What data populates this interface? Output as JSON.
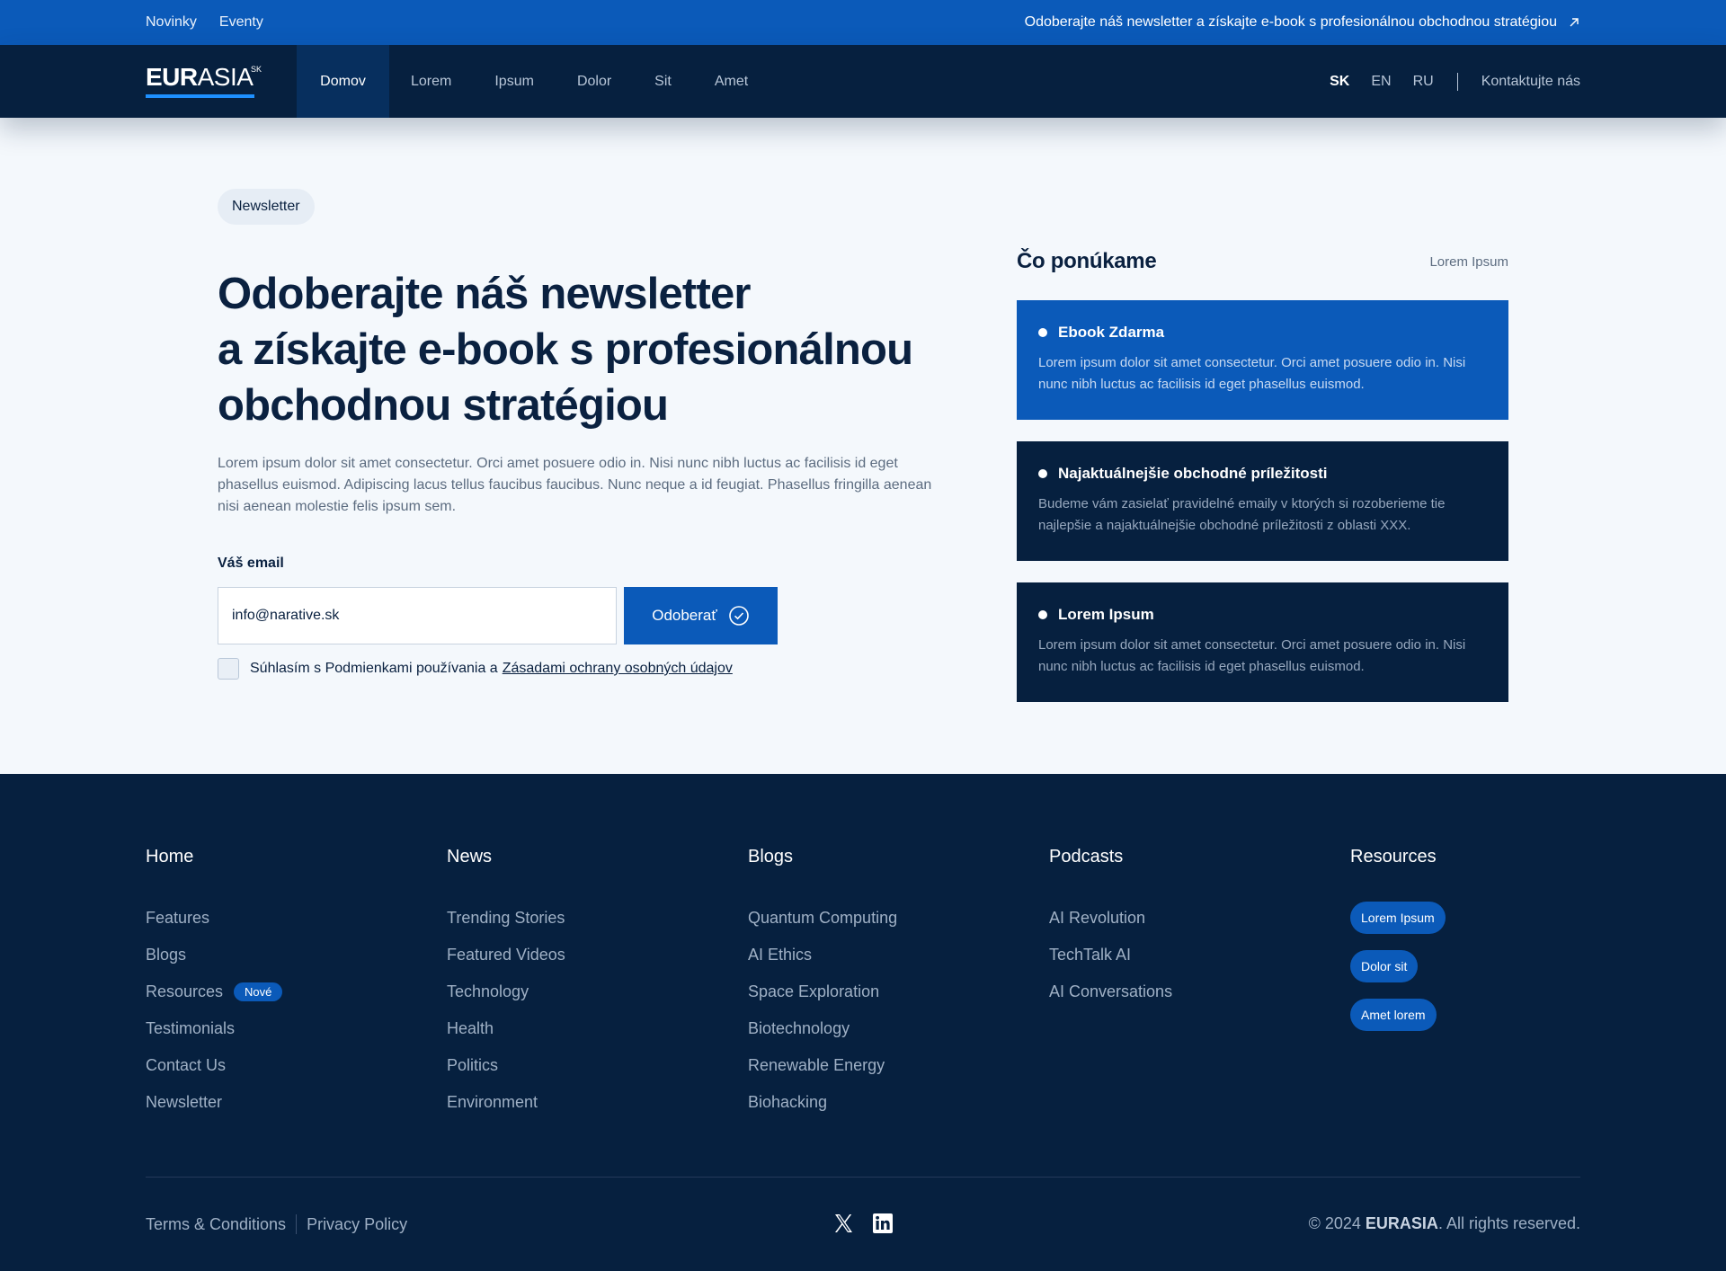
{
  "topbar": {
    "links": [
      "Novinky",
      "Eventy"
    ],
    "promo": "Odoberajte náš newsletter a získajte e-book s profesionálnou obchodnou stratégiou"
  },
  "nav": {
    "logo_bold": "EUR",
    "logo_light": "ASIA",
    "logo_sup": "SK",
    "items": [
      "Domov",
      "Lorem",
      "Ipsum",
      "Dolor",
      "Sit",
      "Amet"
    ],
    "languages": [
      "SK",
      "EN",
      "RU"
    ],
    "contact": "Kontaktujte nás"
  },
  "hero": {
    "badge": "Newsletter",
    "headline": [
      "Odoberajte náš newsletter",
      "a získajte e-book s profesionálnou",
      "obchodnou stratégiou"
    ],
    "lead": "Lorem ipsum dolor sit amet consectetur. Orci amet posuere odio in. Nisi nunc nibh luctus ac facilisis id eget phasellus euismod. Adipiscing lacus tellus faucibus faucibus. Nunc neque a id feugiat. Phasellus fringilla aenean nisi aenean molestie felis ipsum sem.",
    "email_label": "Váš email",
    "email_value": "info@narative.sk",
    "subscribe": "Odoberať",
    "consent_text": "Súhlasím s Podmienkami používania a",
    "consent_link": "Zásadami ochrany osobných údajov"
  },
  "offer": {
    "title": "Čo ponúkame",
    "aside": "Lorem Ipsum",
    "cards": [
      {
        "title": "Ebook Zdarma",
        "body": "Lorem ipsum dolor sit amet consectetur. Orci amet posuere odio in. Nisi nunc nibh luctus ac facilisis id eget phasellus euismod."
      },
      {
        "title": "Najaktuálnejšie obchodné príležitosti",
        "body": "Budeme vám zasielať pravidelné emaily v ktorých si rozoberieme tie najlepšie a najaktuálnejšie obchodné príležitosti z oblasti XXX."
      },
      {
        "title": "Lorem Ipsum",
        "body": "Lorem ipsum dolor sit amet consectetur. Orci amet posuere odio in. Nisi nunc nibh luctus ac facilisis id eget phasellus euismod."
      }
    ]
  },
  "footer": {
    "home": {
      "title": "Home",
      "items": [
        "Features",
        "Blogs",
        "Resources",
        "Testimonials",
        "Contact Us",
        "Newsletter"
      ],
      "new_badge": "Nové"
    },
    "news": {
      "title": "News",
      "items": [
        "Trending Stories",
        "Featured Videos",
        "Technology",
        "Health",
        "Politics",
        "Environment"
      ]
    },
    "blogs": {
      "title": "Blogs",
      "items": [
        "Quantum Computing",
        "AI Ethics",
        "Space Exploration",
        "Biotechnology",
        "Renewable Energy",
        "Biohacking"
      ]
    },
    "podcasts": {
      "title": "Podcasts",
      "items": [
        "AI Revolution",
        "TechTalk AI",
        "AI Conversations"
      ]
    },
    "resources": {
      "title": "Resources",
      "pills": [
        "Lorem Ipsum",
        "Dolor sit",
        "Amet lorem"
      ]
    },
    "terms": "Terms & Conditions",
    "privacy": "Privacy Policy",
    "social_icons": [
      "x-icon",
      "linkedin-icon"
    ],
    "copyright_prefix": "© 2024",
    "copyright_brand": "EURASIA",
    "copyright_suffix": ". All rights reserved."
  },
  "colors": {
    "primary": "#0b5ab9",
    "navy": "#06203f",
    "background": "#f4f8fc"
  }
}
